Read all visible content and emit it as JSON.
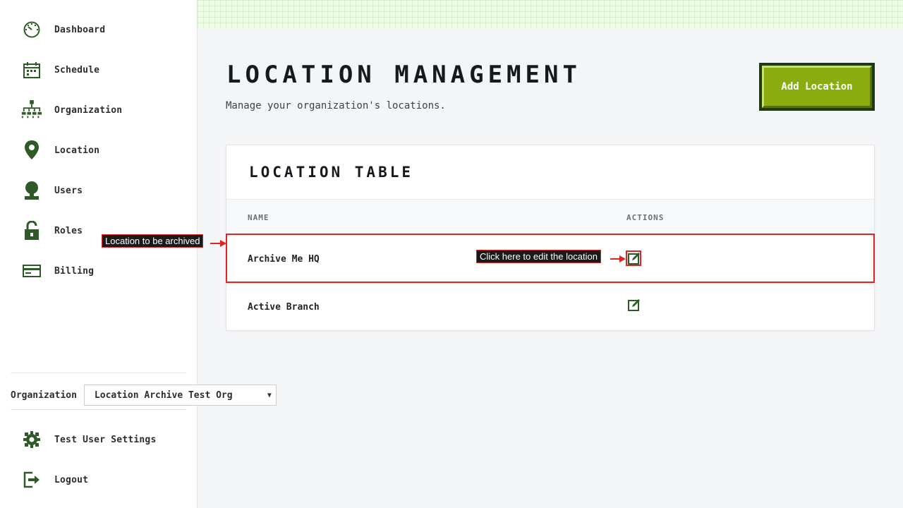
{
  "sidebar": {
    "items": [
      {
        "label": "Dashboard",
        "icon": "dashboard-icon"
      },
      {
        "label": "Schedule",
        "icon": "calendar-icon"
      },
      {
        "label": "Organization",
        "icon": "org-chart-icon"
      },
      {
        "label": "Location",
        "icon": "map-pin-icon"
      },
      {
        "label": "Users",
        "icon": "user-icon"
      },
      {
        "label": "Roles",
        "icon": "lock-icon"
      },
      {
        "label": "Billing",
        "icon": "credit-card-icon"
      }
    ],
    "organization": {
      "label": "Organization",
      "selected": "Location Archive Test Org"
    },
    "bottom_items": [
      {
        "label": "Test User Settings",
        "icon": "gear-icon"
      },
      {
        "label": "Logout",
        "icon": "logout-icon"
      }
    ]
  },
  "header": {
    "title": "LOCATION MANAGEMENT",
    "subtitle": "Manage your organization's locations.",
    "add_button": "Add Location"
  },
  "table": {
    "title": "LOCATION TABLE",
    "columns": [
      "NAME",
      "ACTIONS"
    ],
    "rows": [
      {
        "name": "Archive Me HQ",
        "action_icon": "edit-icon"
      },
      {
        "name": "Active Branch",
        "action_icon": "edit-icon"
      }
    ]
  },
  "annotations": {
    "row_callout": "Location to be archived",
    "edit_callout": "Click here to edit the location"
  },
  "colors": {
    "accent_green": "#8aac0f",
    "dark_green": "#1c3a14",
    "icon_green": "#2f5a27",
    "annotation_red": "#e02424"
  }
}
